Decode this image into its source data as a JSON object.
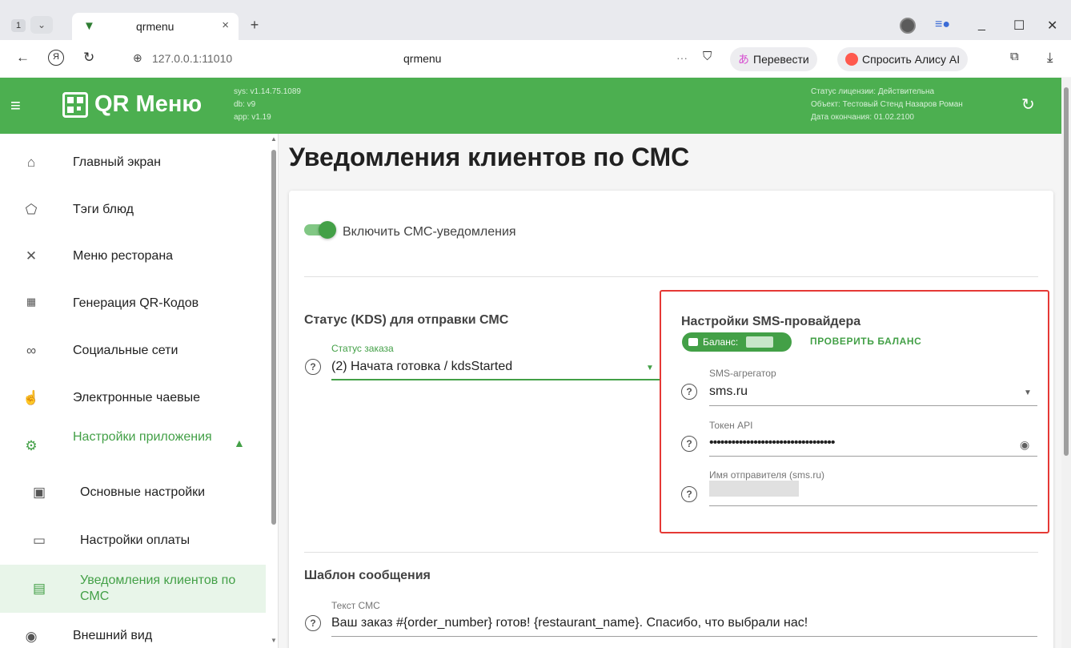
{
  "browser": {
    "tab_counter": "1",
    "tab_dropdown": "⌄",
    "tab_title": "qrmenu",
    "tab_close": "×",
    "new_tab": "+",
    "url": "127.0.0.1:11010",
    "page_title": "qrmenu",
    "translate_label": "Перевести",
    "alice_label": "Спросить Алису AI",
    "more": "···"
  },
  "app": {
    "brand": "QR Меню",
    "versions": [
      "sys: v1.14.75.1089",
      "db: v9",
      "app: v1.19"
    ],
    "license": [
      "Статус лицензии: Действительна",
      "Объект: Тестовый Стенд Назаров Роман",
      "Дата окончания: 01.02.2100"
    ]
  },
  "sidebar": {
    "items": [
      {
        "label": "Главный экран",
        "icon": "home-icon"
      },
      {
        "label": "Тэги блюд",
        "icon": "tag-icon"
      },
      {
        "label": "Меню ресторана",
        "icon": "utensils-icon"
      },
      {
        "label": "Генерация QR-Кодов",
        "icon": "qr-icon"
      },
      {
        "label": "Социальные сети",
        "icon": "link-icon"
      },
      {
        "label": "Электронные чаевые",
        "icon": "tips-icon"
      },
      {
        "label": "Настройки приложения",
        "icon": "app-settings-icon"
      },
      {
        "label": "Основные настройки",
        "icon": "basic-settings-icon"
      },
      {
        "label": "Настройки оплаты",
        "icon": "card-icon"
      },
      {
        "label": "Уведомления клиентов по СМС",
        "icon": "message-icon"
      },
      {
        "label": "Внешний вид",
        "icon": "eye-icon"
      }
    ]
  },
  "main": {
    "title": "Уведомления клиентов по СМС",
    "enable_label": "Включить СМС-уведомления",
    "status_section": "Статус (KDS) для отправки СМС",
    "order_status_label": "Статус заказа",
    "order_status_value": "(2) Начата готовка / kdsStarted",
    "provider": {
      "title": "Настройки SMS-провайдера",
      "balance_label": "Баланс:",
      "check_balance": "ПРОВЕРИТЬ БАЛАНС",
      "aggregator_label": "SMS-агрегатор",
      "aggregator_value": "sms.ru",
      "token_label": "Токен API",
      "token_value": "••••••••••••••••••••••••••••••••••",
      "sender_label": "Имя отправителя (sms.ru)"
    },
    "template_section": "Шаблон сообщения",
    "sms_text_label": "Текст СМС",
    "sms_text_value": "Ваш заказ #{order_number} готов! {restaurant_name}. Спасибо, что выбрали нас!"
  }
}
